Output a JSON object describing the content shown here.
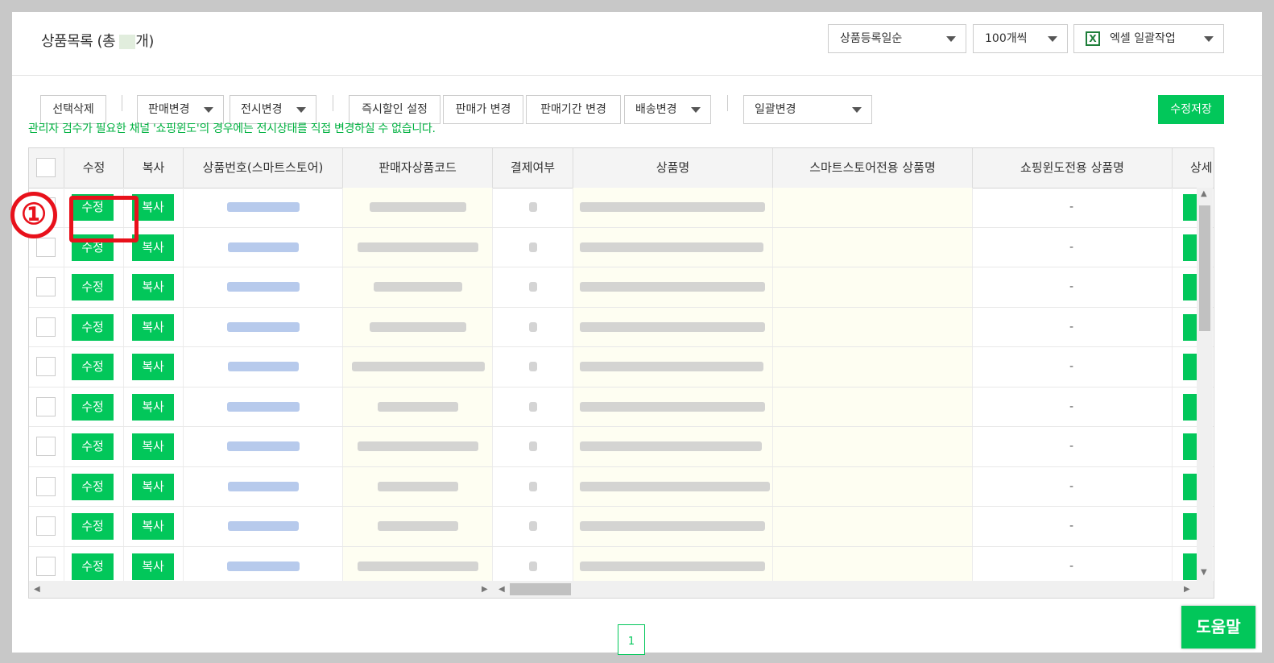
{
  "header": {
    "title_prefix": "상품목록 (총",
    "title_suffix": "개)",
    "sort_select": "상품등록일순",
    "page_size_select": "100개씩",
    "excel_select": "엑셀 일괄작업",
    "excel_icon": "excel-icon"
  },
  "toolbar": {
    "delete_selected": "선택삭제",
    "change_sale": "판매변경",
    "change_display": "전시변경",
    "instant_discount": "즉시할인 설정",
    "change_price": "판매가 변경",
    "change_period": "판매기간 변경",
    "change_shipping": "배송변경",
    "bulk_change": "일괄변경",
    "save_changes": "수정저장",
    "notice": "관리자 검수가 필요한 채널 '쇼핑윈도'의 경우에는 전시상태를 직접 변경하실 수 없습니다."
  },
  "table": {
    "headers": {
      "edit": "수정",
      "copy": "복사",
      "product_no": "상품번호(스마트스토어)",
      "seller_code": "판매자상품코드",
      "payment": "결제여부",
      "product_name": "상품명",
      "smartstore_name": "스마트스토어전용 상품명",
      "shoppingwindow_name": "쇼핑윈도전용 상품명",
      "detail": "상세"
    },
    "row_edit_label": "수정",
    "row_copy_label": "복사",
    "row_count": 10,
    "dash": "-"
  },
  "annotation": {
    "marker": "①"
  },
  "pagination": {
    "current": "1"
  },
  "help_button": "도움말",
  "colors": {
    "accent": "#02c75a",
    "highlight": "#e8111b",
    "notice": "#00b140"
  }
}
